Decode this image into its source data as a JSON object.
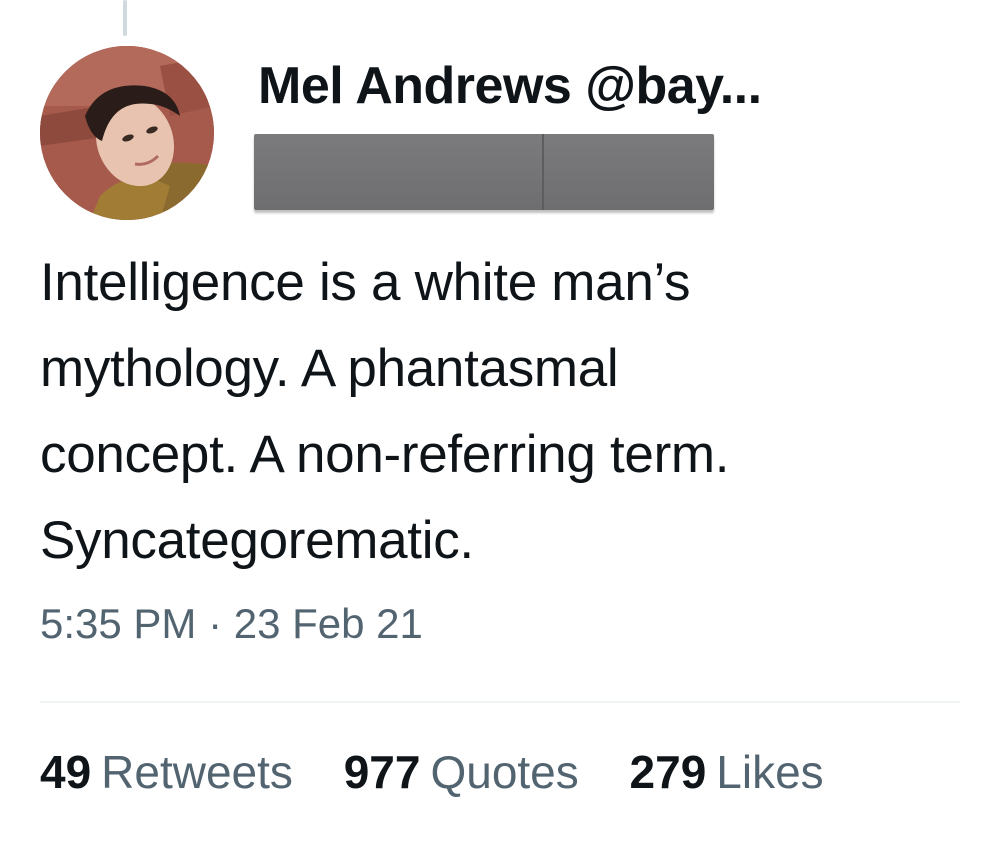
{
  "tweet": {
    "author": {
      "display_name_and_handle": "Mel Andrews @bay..."
    },
    "text_lines": [
      "Intelligence is a white man’s",
      "mythology. A phantasmal",
      "concept. A non-referring term.",
      "Syncategorematic."
    ],
    "timestamp": "5:35 PM · 23 Feb 21",
    "stats": [
      {
        "count": "49",
        "label": "Retweets"
      },
      {
        "count": "977",
        "label": "Quotes"
      },
      {
        "count": "279",
        "label": "Likes"
      }
    ]
  },
  "colors": {
    "text_primary": "#0f1419",
    "text_secondary": "#536471",
    "divider": "#eff3f4",
    "redaction": "#727275"
  }
}
